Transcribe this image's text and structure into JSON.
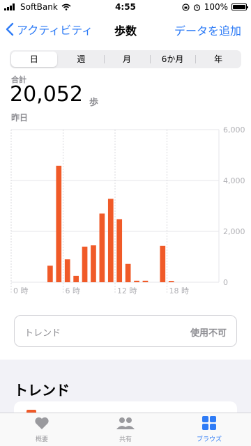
{
  "status_bar": {
    "carrier": "SoftBank",
    "time": "4:55",
    "battery": "100%"
  },
  "nav": {
    "back_label": "アクティビティ",
    "title": "歩数",
    "add_label": "データを追加"
  },
  "segments": {
    "items": [
      "日",
      "週",
      "月",
      "6か月",
      "年"
    ],
    "selected": "日"
  },
  "summary": {
    "label": "合計",
    "value": "20,052",
    "unit": "歩",
    "date": "昨日"
  },
  "chart_data": {
    "type": "bar",
    "categories": [
      "0",
      "1",
      "2",
      "3",
      "4",
      "5",
      "6",
      "7",
      "8",
      "9",
      "10",
      "11",
      "12",
      "13",
      "14",
      "15",
      "16",
      "17",
      "18",
      "19",
      "20",
      "21",
      "22",
      "23"
    ],
    "values": [
      0,
      0,
      0,
      0,
      650,
      4580,
      900,
      250,
      1400,
      1450,
      2700,
      3280,
      2480,
      720,
      60,
      60,
      0,
      1430,
      50,
      0,
      0,
      0,
      0,
      0
    ],
    "y_ticks": [
      "6,000",
      "4,000",
      "2,000",
      "0"
    ],
    "y_tick_values": [
      6000,
      4000,
      2000,
      0
    ],
    "x_tick_labels": [
      "0 時",
      "6 時",
      "12 時",
      "18 時"
    ],
    "x_tick_positions": [
      0,
      6,
      12,
      18
    ],
    "ylim": [
      0,
      6000
    ],
    "bar_color": "#f05a28"
  },
  "trend_card": {
    "label": "トレンド",
    "value": "使用不可"
  },
  "section_title": "トレンド",
  "tabbar": {
    "items": [
      {
        "label": "概要",
        "icon": "heart-icon"
      },
      {
        "label": "共有",
        "icon": "people-icon"
      },
      {
        "label": "ブラウズ",
        "icon": "grid-icon"
      }
    ]
  }
}
